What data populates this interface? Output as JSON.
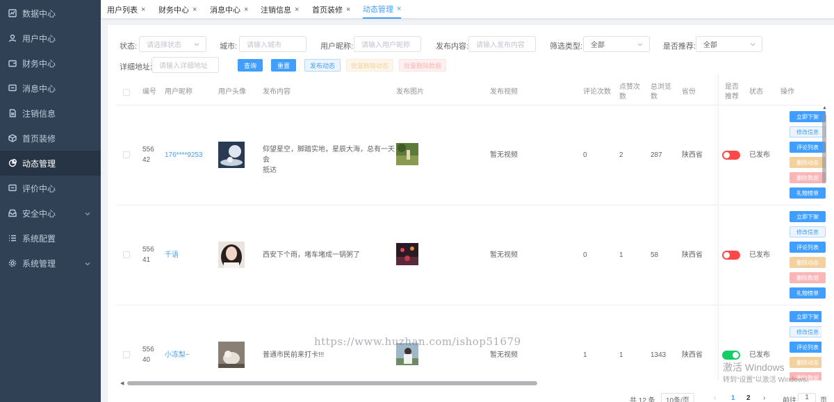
{
  "sidebar": {
    "items": [
      {
        "label": "数据中心",
        "icon": "chart-icon"
      },
      {
        "label": "用户中心",
        "icon": "user-icon"
      },
      {
        "label": "财务中心",
        "icon": "wallet-icon"
      },
      {
        "label": "消息中心",
        "icon": "message-icon"
      },
      {
        "label": "注销信息",
        "icon": "document-icon"
      },
      {
        "label": "首页装修",
        "icon": "box-icon"
      },
      {
        "label": "动态管理",
        "icon": "pie-icon",
        "active": true
      },
      {
        "label": "评价中心",
        "icon": "comment-icon"
      },
      {
        "label": "安全中心",
        "icon": "inbox-icon",
        "expandable": true
      },
      {
        "label": "系统配置",
        "icon": "list-icon"
      },
      {
        "label": "系统管理",
        "icon": "gear-icon",
        "expandable": true
      }
    ]
  },
  "tabs": [
    {
      "label": "用户列表",
      "close": "×"
    },
    {
      "label": "财务中心",
      "close": "×"
    },
    {
      "label": "消息中心",
      "close": "×"
    },
    {
      "label": "注销信息",
      "close": "×"
    },
    {
      "label": "首页装修",
      "close": "×"
    },
    {
      "label": "动态管理",
      "close": "×",
      "active": true
    }
  ],
  "filters": {
    "status_label": "状态:",
    "status_placeholder": "请选择状态",
    "city_label": "城市:",
    "city_placeholder": "请输入城市",
    "nickname_label": "用户昵称:",
    "nickname_placeholder": "请输入用户昵称",
    "content_label": "发布内容:",
    "content_placeholder": "请输入发布内容",
    "type_label": "筛选类型:",
    "type_value": "全部",
    "recommend_label": "是否推荐:",
    "recommend_value": "全部",
    "address_label": "详细地址:",
    "address_placeholder": "请输入详细地址"
  },
  "buttons": {
    "query": "查询",
    "reset": "重置",
    "publish": "发布动态",
    "batch_delete_post": "批量删除动态",
    "batch_delete_data": "批量删除数据"
  },
  "table": {
    "headers": {
      "id": "编号",
      "nickname": "用户昵称",
      "avatar": "用户头像",
      "content": "发布内容",
      "images": "发布图片",
      "video": "发布视频",
      "comments": "评论次数",
      "likes_1": "点赞次",
      "likes_2": "数",
      "views_1": "总浏览",
      "views_2": "数",
      "province": "省份",
      "recommend_1": "是否",
      "recommend_2": "推荐",
      "status": "状态",
      "actions": "操作"
    },
    "rows": [
      {
        "id_1": "556",
        "id_2": "42",
        "nickname": "176****9253",
        "content_1": "仰望星空，脚踏实地，星辰大海，总有一天会",
        "content_2": "抵达",
        "video": "暂无视频",
        "comments": "0",
        "likes": "2",
        "views": "287",
        "province": "陕西省",
        "recommend": false,
        "status": "已发布"
      },
      {
        "id_1": "556",
        "id_2": "41",
        "nickname": "千语",
        "content_1": "西安下个雨，堵车堵成一锅粥了",
        "content_2": "",
        "video": "暂无视频",
        "comments": "0",
        "likes": "1",
        "views": "58",
        "province": "陕西省",
        "recommend": false,
        "status": "已发布"
      },
      {
        "id_1": "556",
        "id_2": "40",
        "nickname": "小冻梨~",
        "content_1": "普通市民前来打卡!!!",
        "content_2": "",
        "video": "暂无视频",
        "comments": "1",
        "likes": "1",
        "views": "1343",
        "province": "陕西省",
        "recommend": true,
        "status": "已发布"
      }
    ],
    "row_actions": [
      "立即下架",
      "修改信息",
      "评论列表",
      "删除动态",
      "删除数据",
      "礼物榜单"
    ]
  },
  "pagination": {
    "total": "共 12 条",
    "page_size": "10条/页",
    "prev": "‹",
    "page_1": "1",
    "page_2": "2",
    "next": "›",
    "goto_label": "前往",
    "goto_value": "1",
    "goto_suffix": "页"
  },
  "watermark": "https://www.huzhan.com/ishop51679",
  "windows_activation": {
    "line1": "激活 Windows",
    "line2": "转到“设置”以激活 Windows。"
  },
  "colors": {
    "sidebar_bg": "#304156",
    "primary": "#409eff",
    "switch_on": "#13ce66",
    "switch_off": "#ff4949"
  }
}
